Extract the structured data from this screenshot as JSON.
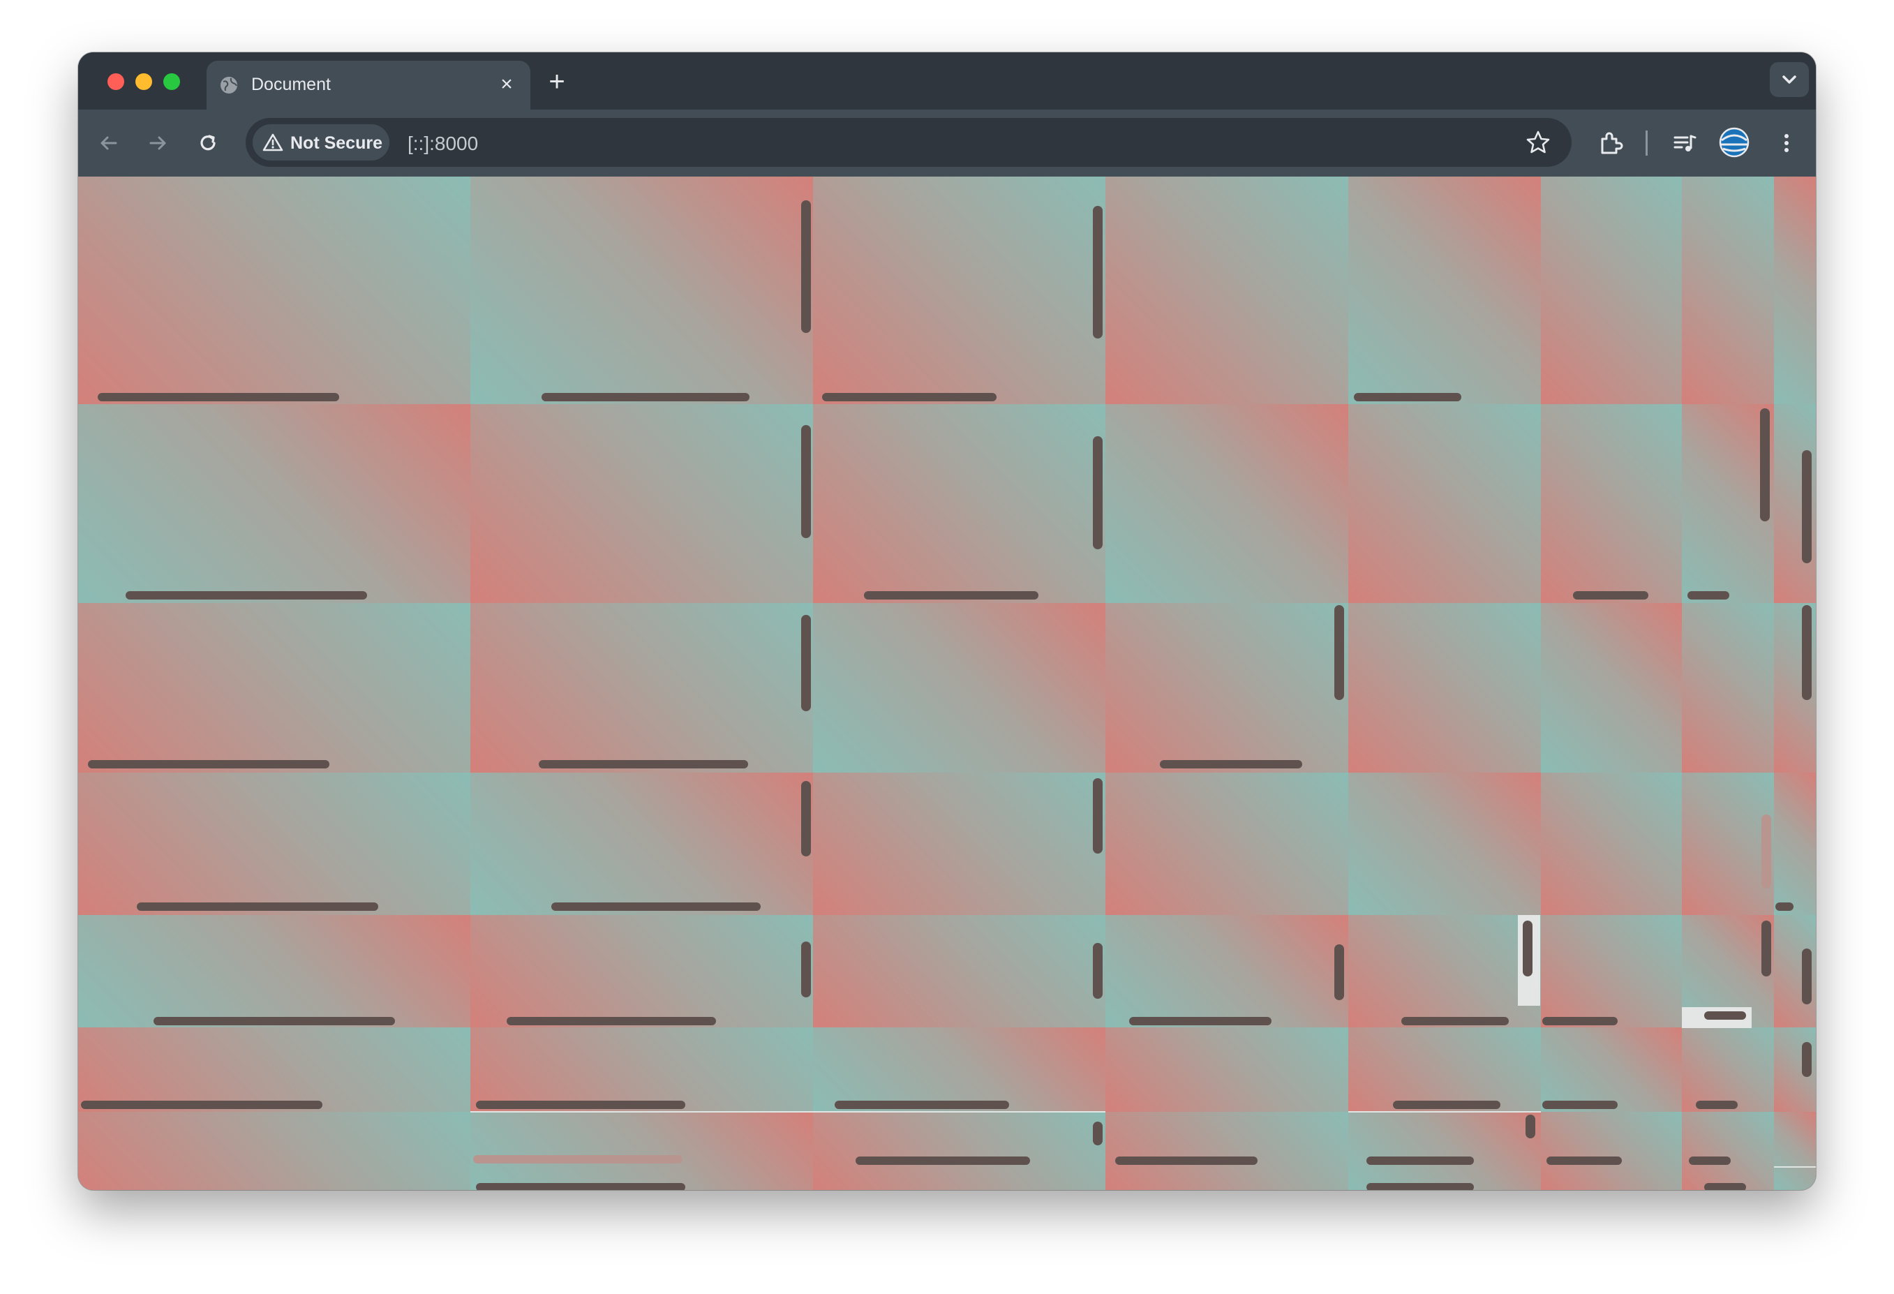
{
  "browser": {
    "tab_title": "Document",
    "security_label": "Not Secure",
    "url": "[::]:8000",
    "close_symbol": "×",
    "new_tab_symbol": "+"
  },
  "icons": [
    "globe-icon",
    "back-arrow-icon",
    "forward-arrow-icon",
    "reload-icon",
    "warning-triangle-icon",
    "star-icon",
    "extensions-icon",
    "media-controls-icon",
    "profile-avatar-icon",
    "kebab-menu-icon",
    "chevron-down-icon",
    "close-icon",
    "plus-icon"
  ],
  "colors": {
    "red_tone": "#d4807a",
    "teal_tone": "#8bbcb4",
    "mid_tone": "#a9a49d",
    "bar_color": "#5e514e",
    "chrome_dark": "#2f363d",
    "chrome_mid": "#434d56"
  }
}
